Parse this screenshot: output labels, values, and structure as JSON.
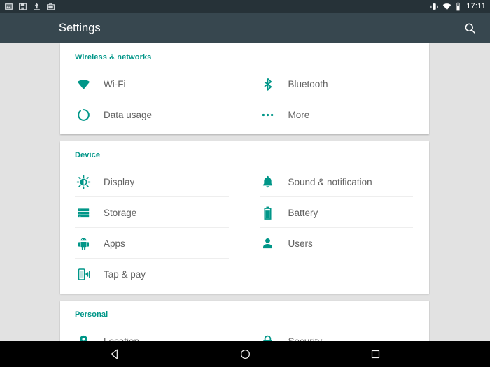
{
  "status_bar": {
    "left_icons": [
      {
        "name": "screenshot-icon"
      },
      {
        "name": "save-icon"
      },
      {
        "name": "upload-icon"
      },
      {
        "name": "work-profile-icon"
      }
    ],
    "right_icons": [
      {
        "name": "vibrate-icon"
      },
      {
        "name": "wifi-icon"
      },
      {
        "name": "battery-icon"
      }
    ],
    "clock": "17:11"
  },
  "app_bar": {
    "title": "Settings",
    "search_icon": "search-icon"
  },
  "colors": {
    "accent": "#009688",
    "app_bar": "#37474f",
    "status_bar": "#263238",
    "background": "#e2e2e2",
    "card": "#ffffff",
    "label": "#616161",
    "divider": "#eeeeee"
  },
  "sections": [
    {
      "id": "wireless-networks",
      "header": "Wireless & networks",
      "items": [
        {
          "label": "Wi-Fi",
          "icon": "wifi-icon"
        },
        {
          "label": "Bluetooth",
          "icon": "bluetooth-icon"
        },
        {
          "label": "Data usage",
          "icon": "data-usage-icon"
        },
        {
          "label": "More",
          "icon": "more-icon"
        }
      ]
    },
    {
      "id": "device",
      "header": "Device",
      "items": [
        {
          "label": "Display",
          "icon": "display-icon"
        },
        {
          "label": "Sound & notification",
          "icon": "bell-icon"
        },
        {
          "label": "Storage",
          "icon": "storage-icon"
        },
        {
          "label": "Battery",
          "icon": "battery-icon"
        },
        {
          "label": "Apps",
          "icon": "android-icon"
        },
        {
          "label": "Users",
          "icon": "user-icon"
        },
        {
          "label": "Tap & pay",
          "icon": "nfc-icon"
        }
      ]
    },
    {
      "id": "personal",
      "header": "Personal",
      "items": [
        {
          "label": "Location",
          "icon": "location-pin-icon"
        },
        {
          "label": "Security",
          "icon": "lock-icon"
        }
      ]
    }
  ],
  "nav_bar": {
    "back": "back-icon",
    "home": "home-icon",
    "recents": "recents-icon"
  }
}
